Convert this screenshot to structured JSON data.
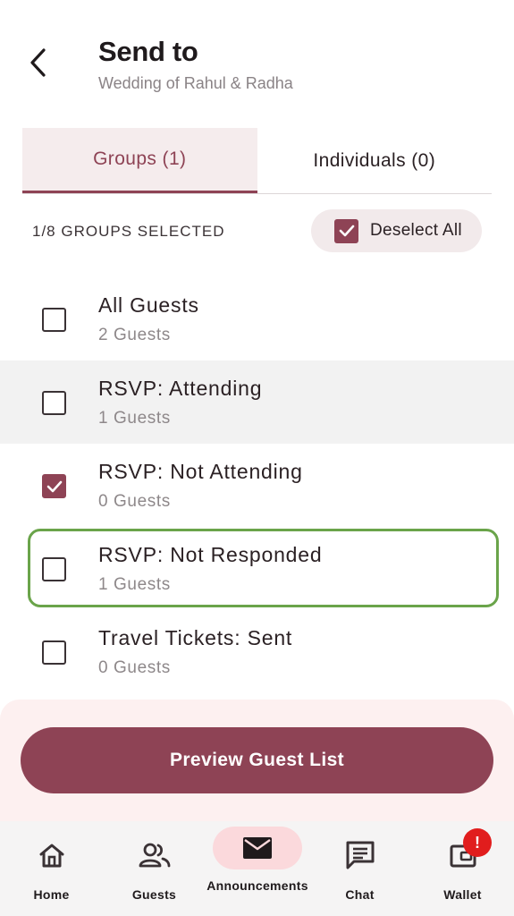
{
  "header": {
    "title": "Send to",
    "subtitle": "Wedding of Rahul & Radha"
  },
  "tabs": [
    {
      "label": "Groups (1)",
      "active": true
    },
    {
      "label": "Individuals (0)",
      "active": false
    }
  ],
  "selection": {
    "count_text": "1/8 GROUPS SELECTED",
    "deselect_label": "Deselect All"
  },
  "groups": [
    {
      "name": "All Guests",
      "count": "2 Guests",
      "checked": false
    },
    {
      "name": "RSVP: Attending",
      "count": "1 Guests",
      "checked": false
    },
    {
      "name": "RSVP: Not Attending",
      "count": "0 Guests",
      "checked": true
    },
    {
      "name": "RSVP: Not Responded",
      "count": "1 Guests",
      "checked": false
    },
    {
      "name": "Travel Tickets: Sent",
      "count": "0 Guests",
      "checked": false
    }
  ],
  "footer": {
    "preview_label": "Preview Guest List"
  },
  "nav": [
    {
      "label": "Home",
      "icon": "home-icon"
    },
    {
      "label": "Guests",
      "icon": "people-icon"
    },
    {
      "label": "Announcements",
      "icon": "mail-icon",
      "active": true
    },
    {
      "label": "Chat",
      "icon": "chat-icon"
    },
    {
      "label": "Wallet",
      "icon": "wallet-icon"
    }
  ],
  "wallet_badge": "!",
  "colors": {
    "accent": "#8e4355",
    "accent_light": "#f5eced",
    "focus": "#6aa44a",
    "badge": "#e11d1d"
  }
}
